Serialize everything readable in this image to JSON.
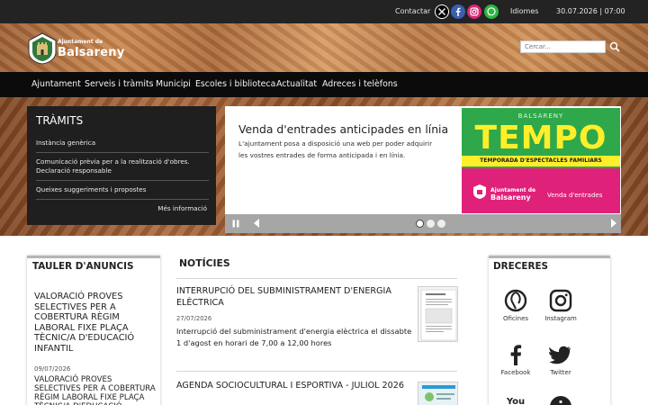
{
  "topbar": {
    "contact": "Contactar",
    "languages": "Idiomes",
    "datetime": "30.07.2026 | 07:00",
    "social_icons": [
      "x-icon",
      "facebook-icon",
      "instagram-icon",
      "whatsapp-icon"
    ]
  },
  "header": {
    "logo_small": "Ajuntament de",
    "logo_big": "Balsareny",
    "search_placeholder": "Cercar..."
  },
  "nav": {
    "items": [
      "Ajuntament",
      "Serveis i tràmits",
      "Municipi",
      "Escoles i biblioteca",
      "Actualitat",
      "Adreces i telèfons"
    ]
  },
  "tramits": {
    "title": "TRÀMITS",
    "items": [
      "Instància genèrica",
      "Comunicació prèvia per a la realització d'obres. Declaració responsable",
      "Queixes suggeriments i propostes"
    ],
    "more": "Més informació"
  },
  "slide": {
    "title": "Venda d'entrades anticipades en línia",
    "text": "L'ajuntament posa a disposició una web per poder adquirir les vostres entrades de forma anticipada i en línia.",
    "banner": {
      "town": "BALSARENY",
      "brand": "TEMPO",
      "subtitle": "TEMPORADA D'ESPECTACLES FAMILIARS",
      "ajuntament_small": "Ajuntament de",
      "ajuntament_big": "Balsareny",
      "cta": "Venda d'entrades"
    },
    "dots_total": 3,
    "dots_active": 1,
    "colors": {
      "banner_green": "#2ea84a",
      "banner_yellow": "#ffef2a",
      "banner_pink": "#e0217a"
    }
  },
  "tauler": {
    "title": "TAULER D'ANUNCIS",
    "item_title": "VALORACIÓ PROVES SELECTIVES PER A COBERTURA RÈGIM LABORAL FIXE PLAÇA TÈCNIC/A D'EDUCACIÓ INFANTIL",
    "date": "09/07/2026",
    "item2": "VALORACIÓ PROVES SELECTIVES PER A COBERTURA RÈGIM LABORAL FIXE PLAÇA TÈCNIC/A D'EDUCACIÓ INFANTIL"
  },
  "noticies": {
    "title": "NOTÍCIES",
    "items": [
      {
        "title": "INTERRUPCIÓ DEL SUBMINISTRAMENT D'ENERGIA ELÈCTRICA",
        "date": "27/07/2026",
        "text": "Interrupció del subministrament d'energia elèctrica el dissabte 1 d'agost en horari de 7,00 a 12,00 hores"
      },
      {
        "title": "AGENDA SOCIOCULTURAL I ESPORTIVA - JULIOL 2026"
      }
    ]
  },
  "dreceres": {
    "title": "DRECERES",
    "items": [
      {
        "label": "Oficines",
        "icon": "oficines-icon"
      },
      {
        "label": "Instagram",
        "icon": "instagram-icon"
      },
      {
        "label": "Facebook",
        "icon": "facebook-icon"
      },
      {
        "label": "Twitter",
        "icon": "twitter-icon"
      },
      {
        "label": "",
        "icon": "youtube-icon"
      },
      {
        "label": "",
        "icon": "info-icon"
      }
    ]
  }
}
